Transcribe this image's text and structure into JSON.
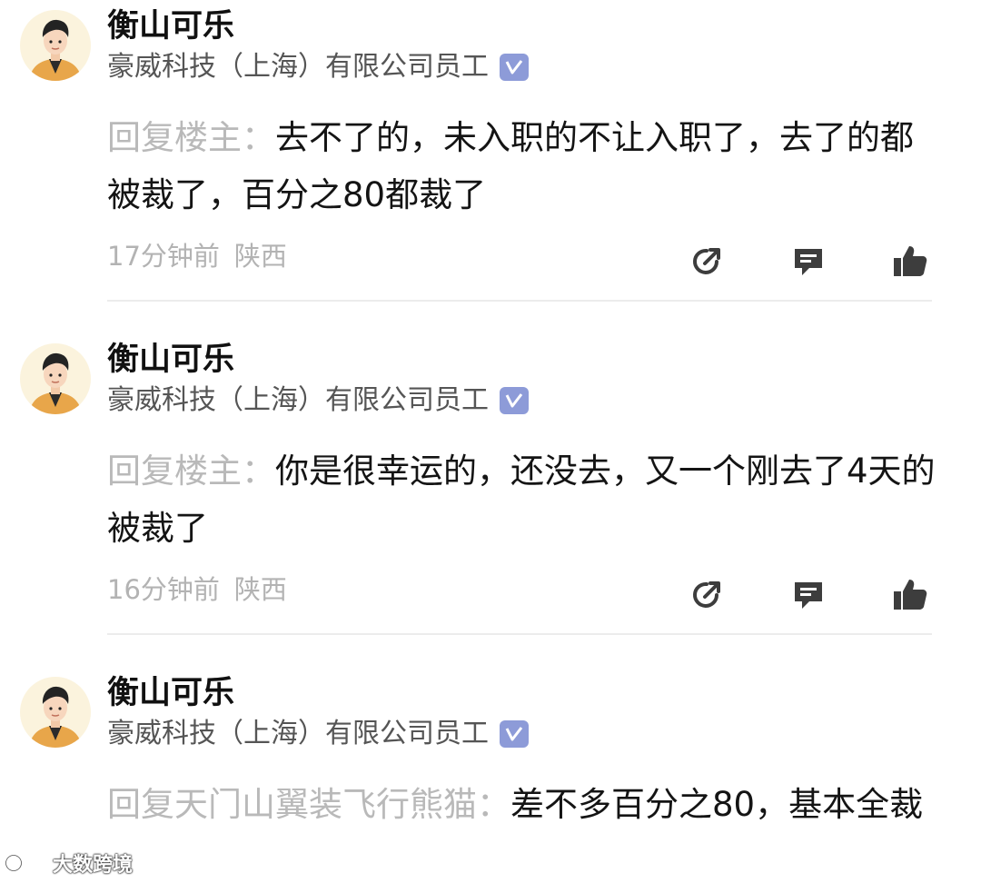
{
  "comments": [
    {
      "username": "衡山可乐",
      "company": "豪威科技（上海）有限公司员工",
      "reply_prefix": "回复楼主：",
      "text": "去不了的，未入职的不让入职了，去了的都被裁了，百分之80都裁了",
      "time": "17分钟前",
      "location": "陕西"
    },
    {
      "username": "衡山可乐",
      "company": "豪威科技（上海）有限公司员工",
      "reply_prefix": "回复楼主：",
      "text": "你是很幸运的，还没去，又一个刚去了4天的被裁了",
      "time": "16分钟前",
      "location": "陕西"
    },
    {
      "username": "衡山可乐",
      "company": "豪威科技（上海）有限公司员工",
      "reply_prefix": "回复天门山翼装飞行熊猫：",
      "text": "差不多百分之80，基本全裁",
      "time": "",
      "location": ""
    }
  ],
  "icons": {
    "verified": "verified-badge-icon",
    "share": "share-icon",
    "reply": "reply-icon",
    "like": "like-icon"
  },
  "colors": {
    "verified_badge": "#8d9bd8",
    "reply_prefix": "#b9b9b9",
    "meta_text": "#b3b3b3",
    "action_icon": "#3d3d3d"
  },
  "watermark": {
    "text": "大数跨境"
  }
}
